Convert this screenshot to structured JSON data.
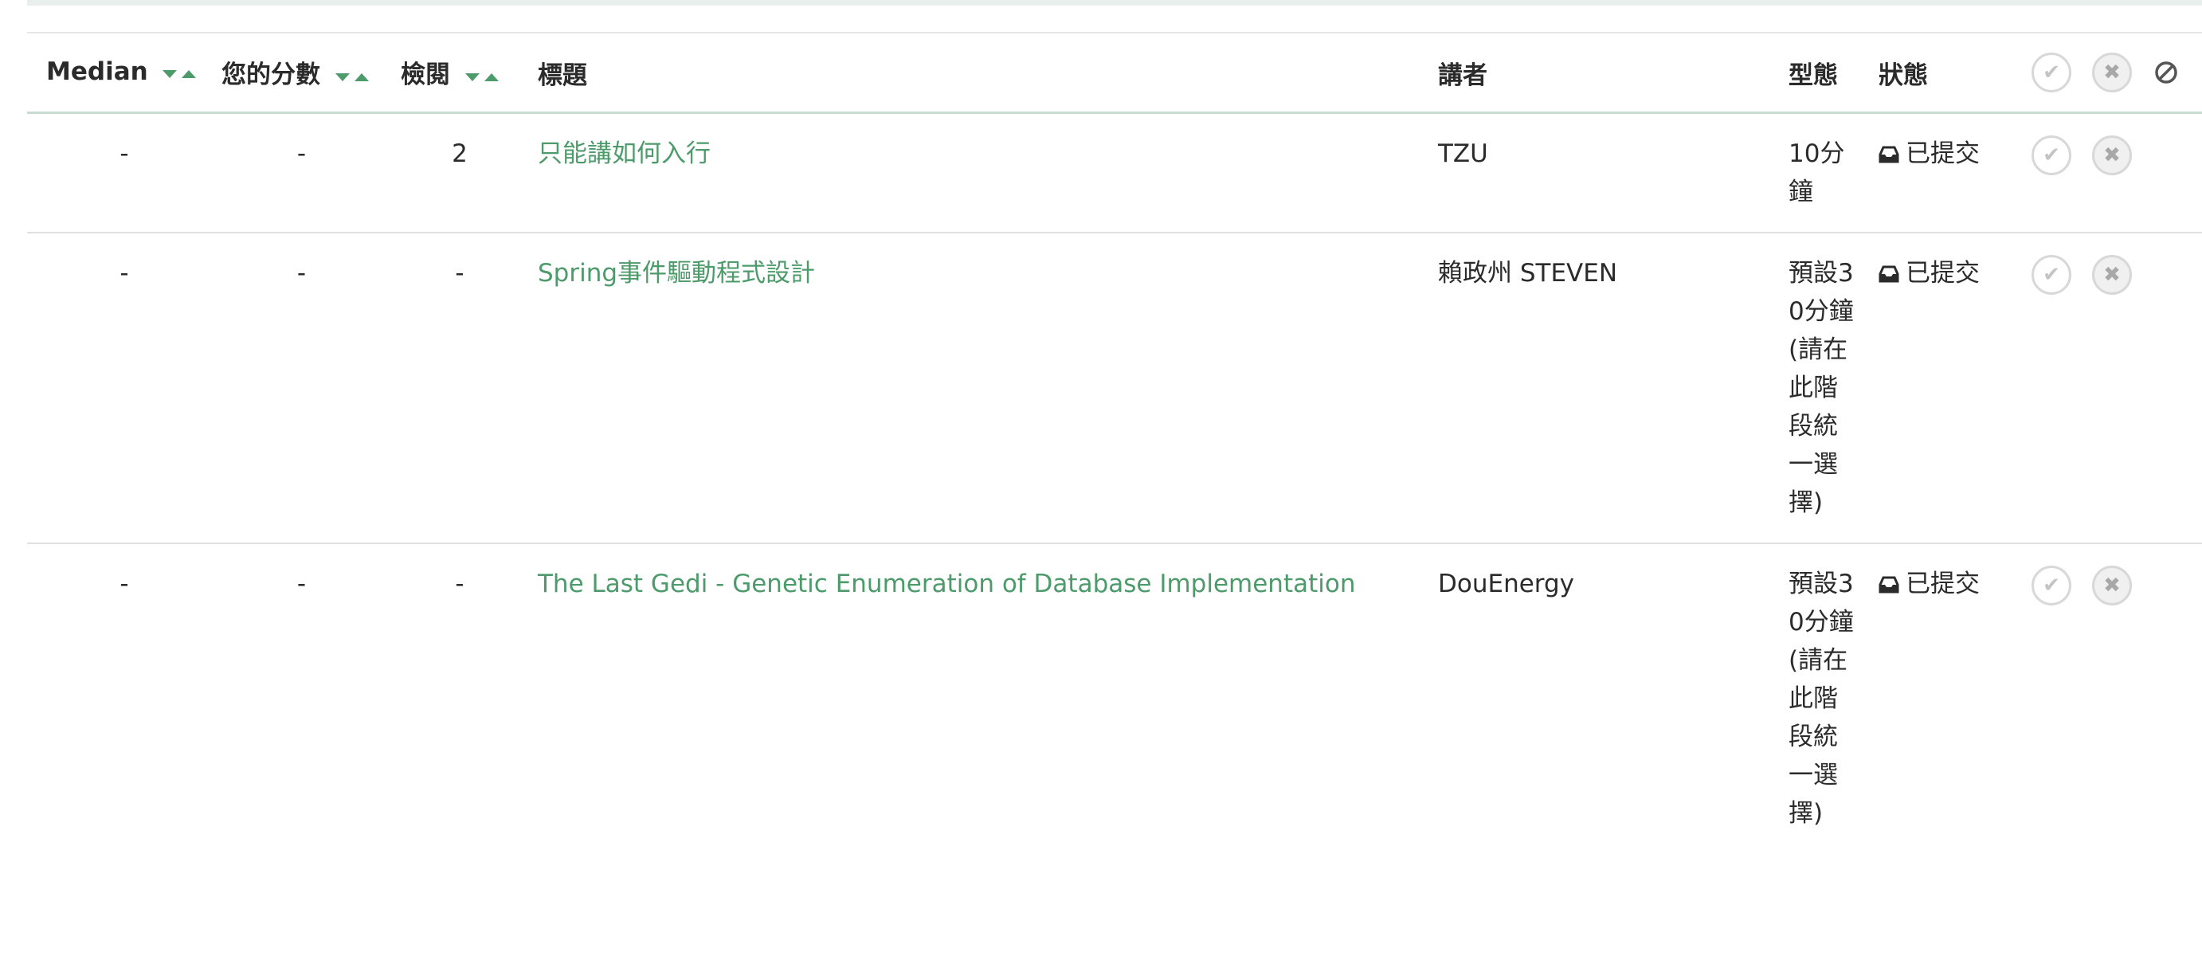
{
  "columns": {
    "median": "Median",
    "your_score": "您的分數",
    "reviews": "檢閱",
    "title": "標題",
    "speaker": "講者",
    "type": "型態",
    "status": "狀態"
  },
  "rows": [
    {
      "median": "-",
      "your_score": "-",
      "reviews": "2",
      "title": "只能講如何入行",
      "speaker": "TZU",
      "type": "10分鐘",
      "status": "已提交"
    },
    {
      "median": "-",
      "your_score": "-",
      "reviews": "-",
      "title": "Spring事件驅動程式設計",
      "speaker": "賴政州 STEVEN",
      "type": "預設30分鐘(請在此階段統一選擇)",
      "status": "已提交"
    },
    {
      "median": "-",
      "your_score": "-",
      "reviews": "-",
      "title": "The Last Gedi - Genetic Enumeration of Database Implementation",
      "speaker": "DouEnergy",
      "type": "預設30分鐘(請在此階段統一選擇)",
      "status": "已提交"
    }
  ],
  "icons": {
    "accept": "check-icon",
    "reject": "x-icon",
    "ignore": "ban-icon",
    "status": "inbox-icon",
    "sort_desc": "caret-down-icon",
    "sort_asc": "caret-up-icon"
  },
  "colors": {
    "link": "#4d9a6a",
    "header_border": "#c9dcd2"
  }
}
